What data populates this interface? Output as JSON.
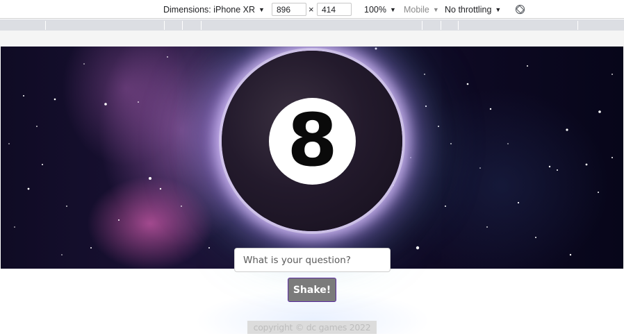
{
  "devtools": {
    "dimensions_label": "Dimensions: iPhone XR",
    "width": "896",
    "height": "414",
    "times": "×",
    "zoom": "100%",
    "device_type": "Mobile",
    "throttling": "No throttling",
    "caret": "▼",
    "rotate_icon": "rotate-icon"
  },
  "app": {
    "ball_number": "8",
    "question_placeholder": "What is your question?",
    "question_value": "",
    "shake_label": "Shake!",
    "copyright": "copyright © dc games 2022",
    "colors": {
      "button_bg": "#7b7b7b",
      "button_border": "#5b2da0",
      "ball": "#231a2c",
      "ball_glow": "#dcc8ff"
    }
  }
}
